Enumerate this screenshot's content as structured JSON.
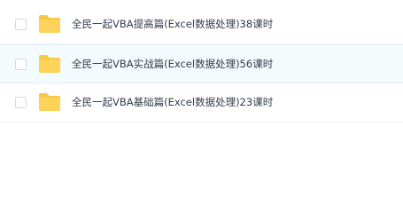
{
  "file_list": {
    "items": [
      {
        "name": "全民一起VBA提高篇(Excel数据处理)38课时",
        "type_icon": "folder-icon",
        "hovered": false
      },
      {
        "name": "全民一起VBA实战篇(Excel数据处理)56课时",
        "type_icon": "folder-icon",
        "hovered": true
      },
      {
        "name": "全民一起VBA基础篇(Excel数据处理)23课时",
        "type_icon": "folder-icon",
        "hovered": false
      }
    ]
  },
  "colors": {
    "folder": "#fdd35a",
    "folder_tab": "#f9c744",
    "row_hover": "#f4fbfd",
    "text": "#333c4a"
  }
}
